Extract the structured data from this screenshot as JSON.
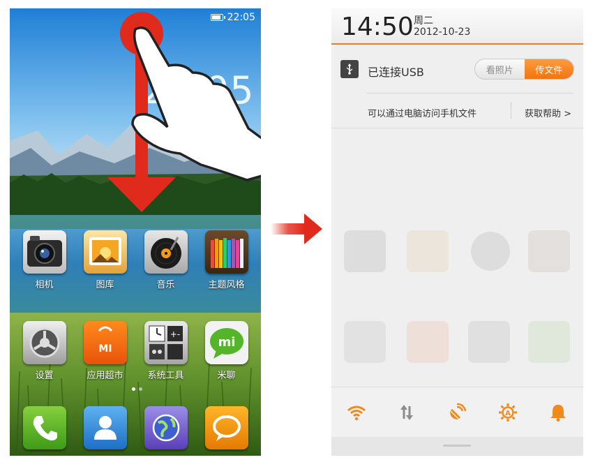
{
  "left_screen": {
    "status_time": "22:05",
    "lock_clock": "22:05",
    "apps_row1": [
      {
        "label": "相机",
        "icon": "camera-icon"
      },
      {
        "label": "图库",
        "icon": "gallery-icon"
      },
      {
        "label": "音乐",
        "icon": "music-icon"
      },
      {
        "label": "主题风格",
        "icon": "theme-icon"
      }
    ],
    "apps_row2": [
      {
        "label": "设置",
        "icon": "settings-icon"
      },
      {
        "label": "应用超市",
        "icon": "market-icon",
        "badge": "MI"
      },
      {
        "label": "系统工具",
        "icon": "tools-icon"
      },
      {
        "label": "米聊",
        "icon": "mitalk-icon",
        "badge": "mi"
      }
    ],
    "dock": [
      {
        "icon": "phone-icon"
      },
      {
        "icon": "contacts-icon"
      },
      {
        "icon": "browser-icon"
      },
      {
        "icon": "sms-icon"
      }
    ],
    "gesture": {
      "direction": "swipe-down",
      "color": "#e02a1b"
    }
  },
  "right_screen": {
    "time": "14:50",
    "weekday": "周二",
    "date": "2012-10-23",
    "usb": {
      "title": "已连接USB",
      "option_photos": "看照片",
      "option_files": "传文件",
      "selected": "传文件",
      "description": "可以通过电脑访问手机文件",
      "help": "获取帮助 >"
    },
    "quick_toggles": [
      "wifi-icon",
      "sync-icon",
      "gps-icon",
      "auto-brightness-icon",
      "sound-icon"
    ],
    "accent_color": "#ef7d17"
  }
}
